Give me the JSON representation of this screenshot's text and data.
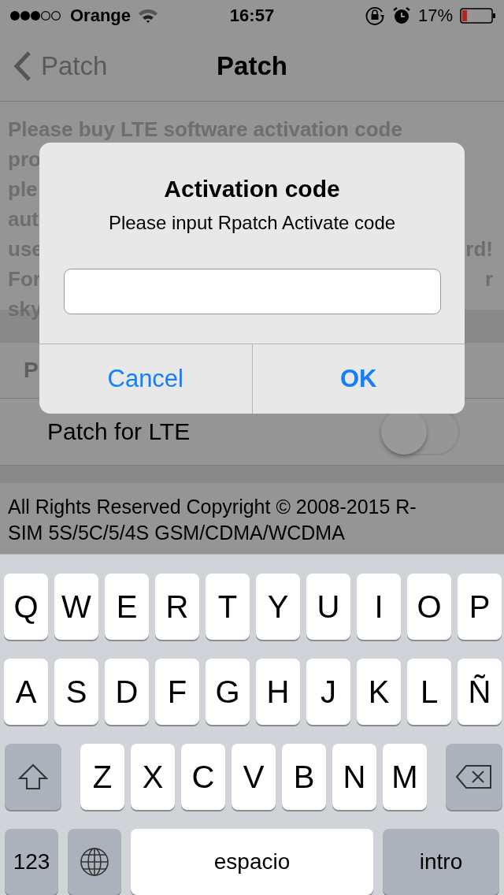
{
  "status_bar": {
    "carrier": "Orange",
    "time": "16:57",
    "battery": "17%"
  },
  "nav": {
    "back": "Patch",
    "title": "Patch"
  },
  "info_lines": [
    {
      "left": "Please buy LTE software activation code"
    },
    {
      "left": "pro"
    },
    {
      "left": "ple"
    },
    {
      "left": "aut"
    },
    {
      "left": "use",
      "right": "rd!"
    },
    {
      "left": "For",
      "right": "r"
    },
    {
      "left": "sky"
    }
  ],
  "rows": [
    {
      "kind": "text",
      "label": "P"
    },
    {
      "kind": "switch",
      "label": "Patch for LTE",
      "on": false
    }
  ],
  "footer": [
    "All Rights Reserved Copyright © 2008-2015 R-",
    "SIM 5S/5C/5/4S GSM/CDMA/WCDMA"
  ],
  "dialog": {
    "title": "Activation code",
    "message": "Please input Rpatch Activate code",
    "buttons": [
      {
        "label": "Cancel",
        "bold": false
      },
      {
        "label": "OK",
        "bold": true
      }
    ]
  },
  "keyboard": [
    [
      {
        "kind": "letter",
        "label": "Q"
      },
      {
        "kind": "letter",
        "label": "W"
      },
      {
        "kind": "letter",
        "label": "E"
      },
      {
        "kind": "letter",
        "label": "R"
      },
      {
        "kind": "letter",
        "label": "T"
      },
      {
        "kind": "letter",
        "label": "Y"
      },
      {
        "kind": "letter",
        "label": "U"
      },
      {
        "kind": "letter",
        "label": "I"
      },
      {
        "kind": "letter",
        "label": "O"
      },
      {
        "kind": "letter",
        "label": "P"
      }
    ],
    [
      {
        "kind": "letter",
        "label": "A"
      },
      {
        "kind": "letter",
        "label": "S"
      },
      {
        "kind": "letter",
        "label": "D"
      },
      {
        "kind": "letter",
        "label": "F"
      },
      {
        "kind": "letter",
        "label": "G"
      },
      {
        "kind": "letter",
        "label": "H"
      },
      {
        "kind": "letter",
        "label": "J"
      },
      {
        "kind": "letter",
        "label": "K"
      },
      {
        "kind": "letter",
        "label": "L"
      },
      {
        "kind": "letter",
        "label": "Ñ"
      }
    ],
    [
      {
        "kind": "shift"
      },
      {
        "kind": "letter",
        "label": "Z"
      },
      {
        "kind": "letter",
        "label": "X"
      },
      {
        "kind": "letter",
        "label": "C"
      },
      {
        "kind": "letter",
        "label": "V"
      },
      {
        "kind": "letter",
        "label": "B"
      },
      {
        "kind": "letter",
        "label": "N"
      },
      {
        "kind": "letter",
        "label": "M"
      },
      {
        "kind": "delete"
      }
    ],
    [
      {
        "kind": "numbers",
        "label": "123"
      },
      {
        "kind": "globe"
      },
      {
        "kind": "space",
        "label": "espacio"
      },
      {
        "kind": "return",
        "label": "intro"
      }
    ]
  ]
}
